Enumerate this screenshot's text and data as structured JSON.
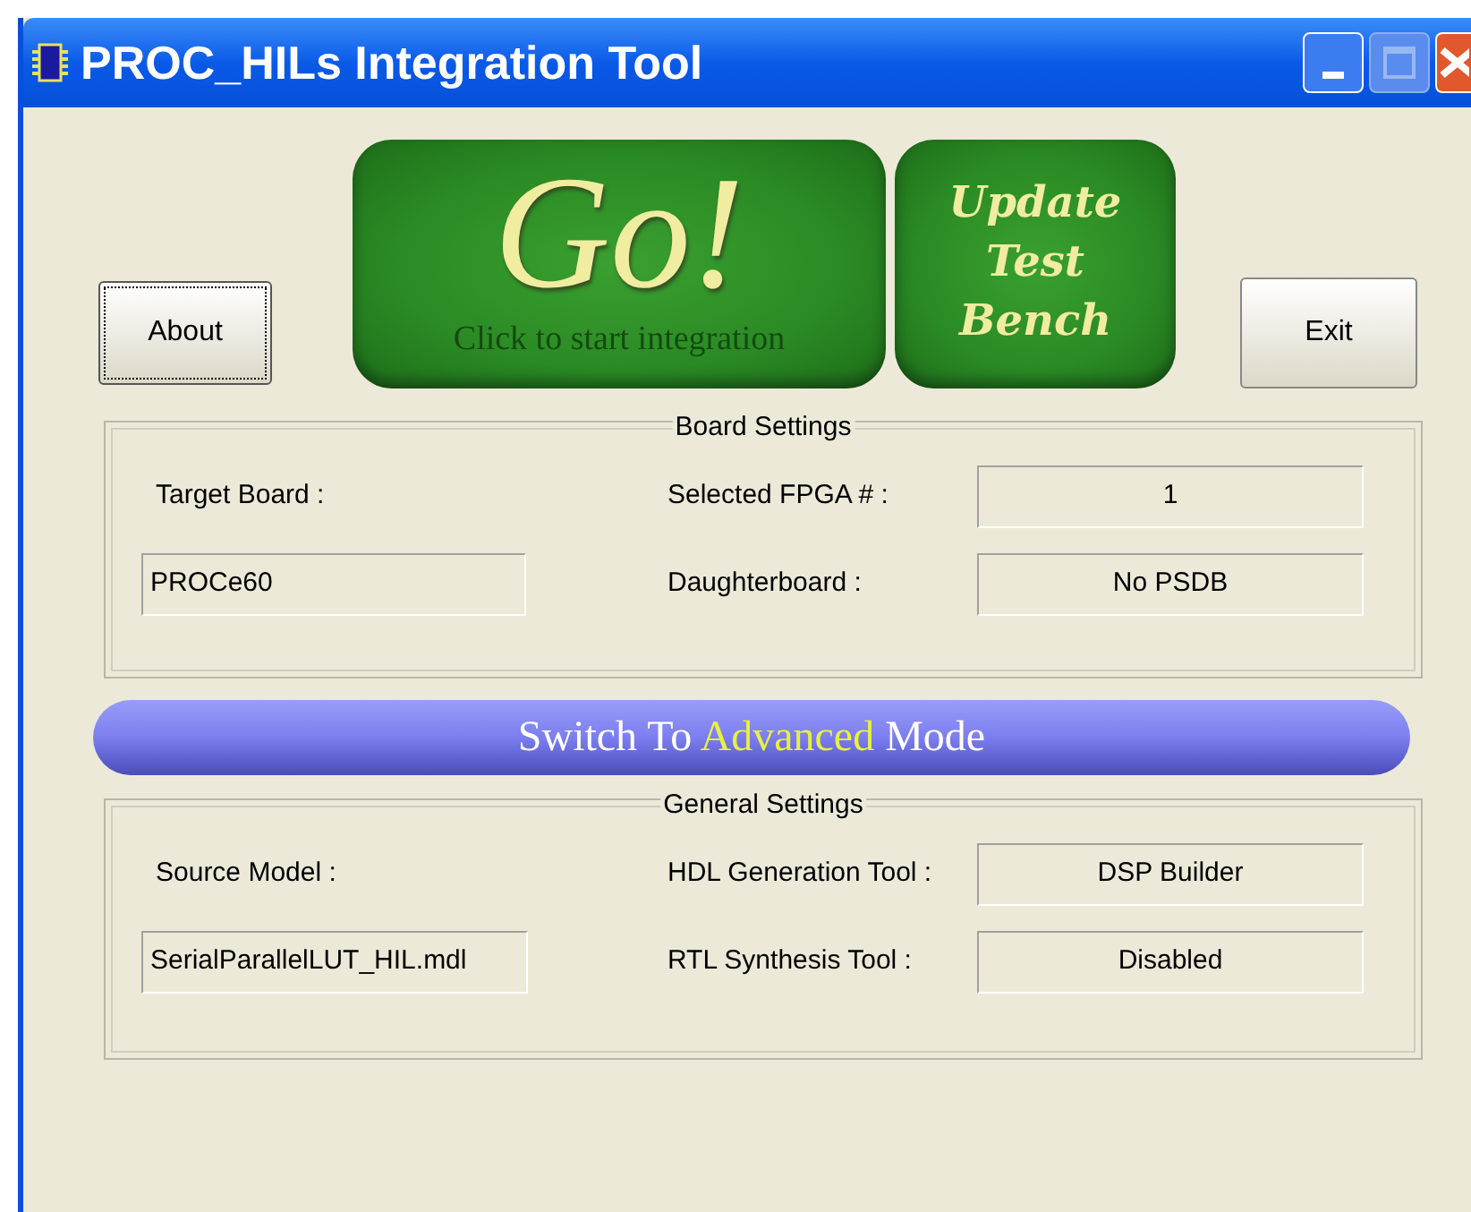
{
  "window": {
    "title": "PROC_HILs Integration Tool",
    "maximize_disabled": true
  },
  "buttons": {
    "about": "About",
    "go": {
      "title": "Go!",
      "subtitle": "Click to start integration"
    },
    "update": "Update Test Bench",
    "exit": "Exit"
  },
  "groups": [
    {
      "title": "Board Settings",
      "left_label": "Target Board :",
      "left_value": "PROCe60",
      "rows": [
        {
          "label": "Selected FPGA # :",
          "value": "1"
        },
        {
          "label": "Daughterboard :",
          "value": "No PSDB"
        }
      ]
    },
    {
      "title": "General Settings",
      "left_label": "Source Model :",
      "left_value": "SerialParallelLUT_HIL.mdl",
      "rows": [
        {
          "label": "HDL Generation Tool :",
          "value": "DSP Builder"
        },
        {
          "label": "RTL Synthesis Tool :",
          "value": "Disabled"
        }
      ]
    }
  ],
  "mode_switch": {
    "prefix": "Switch To",
    "highlight": "Advanced",
    "suffix": "Mode"
  }
}
